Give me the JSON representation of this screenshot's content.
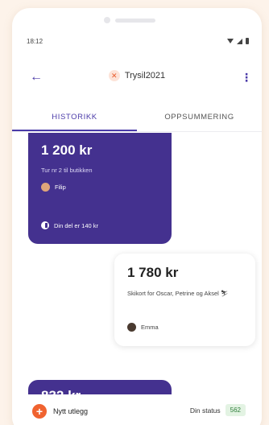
{
  "status_bar": {
    "time": "18:12"
  },
  "app_bar": {
    "title": "Trysil2021",
    "back_icon": "arrow-left-icon",
    "more_icon": "more-vertical-icon"
  },
  "tabs": [
    {
      "label": "HISTORIKK",
      "active": true
    },
    {
      "label": "OPPSUMMERING",
      "active": false
    }
  ],
  "expenses": [
    {
      "amount": "1 200 kr",
      "description": "Tur nr 2 til butikken",
      "payer": "Filip",
      "share": "Din del er 140 kr"
    },
    {
      "amount": "1 780 kr",
      "description": "Skikort for Oscar, Petrine og Aksel ⛷",
      "payer": "Emma"
    },
    {
      "amount": "832 kr"
    }
  ],
  "bottom": {
    "add_label": "Nytt utlegg",
    "status_label": "Din status",
    "status_value": "562"
  },
  "colors": {
    "accent": "#44318f",
    "add": "#f06330",
    "status_badge": "#e3f3e3"
  }
}
